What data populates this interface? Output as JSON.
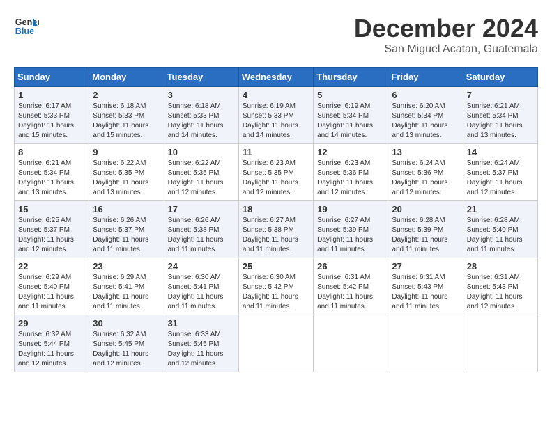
{
  "header": {
    "logo_line1": "General",
    "logo_line2": "Blue",
    "month": "December 2024",
    "location": "San Miguel Acatan, Guatemala"
  },
  "days_of_week": [
    "Sunday",
    "Monday",
    "Tuesday",
    "Wednesday",
    "Thursday",
    "Friday",
    "Saturday"
  ],
  "weeks": [
    [
      {
        "day": 1,
        "rise": "6:17 AM",
        "set": "5:33 PM",
        "daylight": "11 hours and 15 minutes."
      },
      {
        "day": 2,
        "rise": "6:18 AM",
        "set": "5:33 PM",
        "daylight": "11 hours and 15 minutes."
      },
      {
        "day": 3,
        "rise": "6:18 AM",
        "set": "5:33 PM",
        "daylight": "11 hours and 14 minutes."
      },
      {
        "day": 4,
        "rise": "6:19 AM",
        "set": "5:33 PM",
        "daylight": "11 hours and 14 minutes."
      },
      {
        "day": 5,
        "rise": "6:19 AM",
        "set": "5:34 PM",
        "daylight": "11 hours and 14 minutes."
      },
      {
        "day": 6,
        "rise": "6:20 AM",
        "set": "5:34 PM",
        "daylight": "11 hours and 13 minutes."
      },
      {
        "day": 7,
        "rise": "6:21 AM",
        "set": "5:34 PM",
        "daylight": "11 hours and 13 minutes."
      }
    ],
    [
      {
        "day": 8,
        "rise": "6:21 AM",
        "set": "5:34 PM",
        "daylight": "11 hours and 13 minutes."
      },
      {
        "day": 9,
        "rise": "6:22 AM",
        "set": "5:35 PM",
        "daylight": "11 hours and 13 minutes."
      },
      {
        "day": 10,
        "rise": "6:22 AM",
        "set": "5:35 PM",
        "daylight": "11 hours and 12 minutes."
      },
      {
        "day": 11,
        "rise": "6:23 AM",
        "set": "5:35 PM",
        "daylight": "11 hours and 12 minutes."
      },
      {
        "day": 12,
        "rise": "6:23 AM",
        "set": "5:36 PM",
        "daylight": "11 hours and 12 minutes."
      },
      {
        "day": 13,
        "rise": "6:24 AM",
        "set": "5:36 PM",
        "daylight": "11 hours and 12 minutes."
      },
      {
        "day": 14,
        "rise": "6:24 AM",
        "set": "5:37 PM",
        "daylight": "11 hours and 12 minutes."
      }
    ],
    [
      {
        "day": 15,
        "rise": "6:25 AM",
        "set": "5:37 PM",
        "daylight": "11 hours and 12 minutes."
      },
      {
        "day": 16,
        "rise": "6:26 AM",
        "set": "5:37 PM",
        "daylight": "11 hours and 11 minutes."
      },
      {
        "day": 17,
        "rise": "6:26 AM",
        "set": "5:38 PM",
        "daylight": "11 hours and 11 minutes."
      },
      {
        "day": 18,
        "rise": "6:27 AM",
        "set": "5:38 PM",
        "daylight": "11 hours and 11 minutes."
      },
      {
        "day": 19,
        "rise": "6:27 AM",
        "set": "5:39 PM",
        "daylight": "11 hours and 11 minutes."
      },
      {
        "day": 20,
        "rise": "6:28 AM",
        "set": "5:39 PM",
        "daylight": "11 hours and 11 minutes."
      },
      {
        "day": 21,
        "rise": "6:28 AM",
        "set": "5:40 PM",
        "daylight": "11 hours and 11 minutes."
      }
    ],
    [
      {
        "day": 22,
        "rise": "6:29 AM",
        "set": "5:40 PM",
        "daylight": "11 hours and 11 minutes."
      },
      {
        "day": 23,
        "rise": "6:29 AM",
        "set": "5:41 PM",
        "daylight": "11 hours and 11 minutes."
      },
      {
        "day": 24,
        "rise": "6:30 AM",
        "set": "5:41 PM",
        "daylight": "11 hours and 11 minutes."
      },
      {
        "day": 25,
        "rise": "6:30 AM",
        "set": "5:42 PM",
        "daylight": "11 hours and 11 minutes."
      },
      {
        "day": 26,
        "rise": "6:31 AM",
        "set": "5:42 PM",
        "daylight": "11 hours and 11 minutes."
      },
      {
        "day": 27,
        "rise": "6:31 AM",
        "set": "5:43 PM",
        "daylight": "11 hours and 11 minutes."
      },
      {
        "day": 28,
        "rise": "6:31 AM",
        "set": "5:43 PM",
        "daylight": "11 hours and 12 minutes."
      }
    ],
    [
      {
        "day": 29,
        "rise": "6:32 AM",
        "set": "5:44 PM",
        "daylight": "11 hours and 12 minutes."
      },
      {
        "day": 30,
        "rise": "6:32 AM",
        "set": "5:45 PM",
        "daylight": "11 hours and 12 minutes."
      },
      {
        "day": 31,
        "rise": "6:33 AM",
        "set": "5:45 PM",
        "daylight": "11 hours and 12 minutes."
      },
      null,
      null,
      null,
      null
    ]
  ]
}
